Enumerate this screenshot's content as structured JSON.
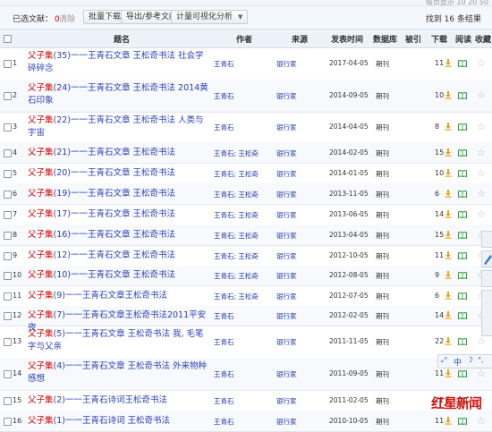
{
  "top": {
    "partial_text": "每页显示 10 20 50"
  },
  "toolbar": {
    "selected_label": "已选文献：",
    "selected_count": "0",
    "clear_label": "清除",
    "btn_batch_download": "批量下载",
    "btn_export": "导出/参考文献",
    "btn_visual": "计量可视化分析",
    "found_text": "找到 16 条结果"
  },
  "columns": {
    "title": "题名",
    "author": "作者",
    "source": "来源",
    "date": "发表时间",
    "db": "数据库",
    "cited": "被引",
    "downloads": "下载",
    "read": "阅读",
    "fav": "收藏"
  },
  "rows": [
    {
      "num": "1",
      "prefix": "父子集",
      "title": "(35)一一王青石文章 王松奇书法 社会学碎碎念",
      "author": "王青石",
      "source": "银行家",
      "date": "2017-04-05",
      "db": "期刊",
      "downloads": "11"
    },
    {
      "num": "2",
      "prefix": "父子集",
      "title": "(24)一一王青石文章 王松奇书法 2014黄石印象",
      "author": "王青石",
      "source": "银行家",
      "date": "2014-09-05",
      "db": "期刊",
      "downloads": "10"
    },
    {
      "num": "3",
      "prefix": "父子集",
      "title": "(22)一一王青石文章 王松奇书法 人类与宇宙",
      "author": "王青石",
      "source": "银行家",
      "date": "2014-04-05",
      "db": "期刊",
      "downloads": "8"
    },
    {
      "num": "4",
      "prefix": "父子集",
      "title": "(21)一一王青石文章 王松奇书法",
      "author": "王青石; 王松奇",
      "source": "银行家",
      "date": "2014-02-05",
      "db": "期刊",
      "downloads": "15"
    },
    {
      "num": "5",
      "prefix": "父子集",
      "title": "(20)一一王青石文章 王松奇书法",
      "author": "王青石; 王松奇",
      "source": "银行家",
      "date": "2014-01-05",
      "db": "期刊",
      "downloads": "10"
    },
    {
      "num": "6",
      "prefix": "父子集",
      "title": "(19)一一王青石文章 王松奇书法",
      "author": "王青石; 王松奇",
      "source": "银行家",
      "date": "2013-11-05",
      "db": "期刊",
      "downloads": "6"
    },
    {
      "num": "7",
      "prefix": "父子集",
      "title": "(17)一一王青石文章 王松奇书法",
      "author": "王青石; 王松奇",
      "source": "银行家",
      "date": "2013-06-05",
      "db": "期刊",
      "downloads": "14"
    },
    {
      "num": "8",
      "prefix": "父子集",
      "title": "(16)一一王青石文章 王松奇书法",
      "author": "王青石; 王松奇",
      "source": "银行家",
      "date": "2013-04-05",
      "db": "期刊",
      "downloads": "15"
    },
    {
      "num": "9",
      "prefix": "父子集",
      "title": "(12)一一王青石文章 王松奇书法",
      "author": "王青石; 王松奇",
      "source": "银行家",
      "date": "2012-10-05",
      "db": "期刊",
      "downloads": "11"
    },
    {
      "num": "10",
      "prefix": "父子集",
      "title": "(10)一一王青石文章 王松奇书法",
      "author": "王青石; 王松奇",
      "source": "银行家",
      "date": "2012-08-05",
      "db": "期刊",
      "downloads": "9"
    },
    {
      "num": "11",
      "prefix": "父子集",
      "title": "(9)一一王青石文章王松奇书法",
      "author": "王青石; 王松奇",
      "source": "银行家",
      "date": "2012-07-05",
      "db": "期刊",
      "downloads": "6"
    },
    {
      "num": "12",
      "prefix": "父子集",
      "title": "(7)一一王青石文章王松奇书法2011平安夜",
      "author": "王青石",
      "source": "银行家",
      "date": "2012-02-05",
      "db": "期刊",
      "downloads": "14"
    },
    {
      "num": "13",
      "prefix": "父子集",
      "title": "(5)一一王青石文章 王松奇书法 我, 毛笔字与父亲",
      "author": "王青石",
      "source": "银行家",
      "date": "2011-11-05",
      "db": "期刊",
      "downloads": "22"
    },
    {
      "num": "14",
      "prefix": "父子集",
      "title": "(4)一一王青石文章 王松奇书法 外来物种感想",
      "author": "王青石",
      "source": "银行家",
      "date": "2011-09-05",
      "db": "期刊",
      "downloads": "11"
    },
    {
      "num": "15",
      "prefix": "父子集",
      "title": "(2)一一王青石诗词王松奇书法",
      "author": "王青石",
      "source": "银行家",
      "date": "2011-02-05",
      "db": "期刊",
      "downloads": "11"
    },
    {
      "num": "16",
      "prefix": "父子集",
      "title": "(1)一一王青石诗词 王松奇书法",
      "author": "王青石",
      "source": "银行家",
      "date": "2010-10-05",
      "db": "期刊",
      "downloads": "11"
    }
  ],
  "ime": {
    "chinese": "中",
    "punct": "°,"
  },
  "watermark": {
    "text": "红星新闻"
  },
  "colors": {
    "highlight": "#d40000",
    "link": "#2a3fb5",
    "header_bg": "#edf2f8",
    "download_icon": "#e8a317",
    "read_icon": "#2e9e3a"
  }
}
